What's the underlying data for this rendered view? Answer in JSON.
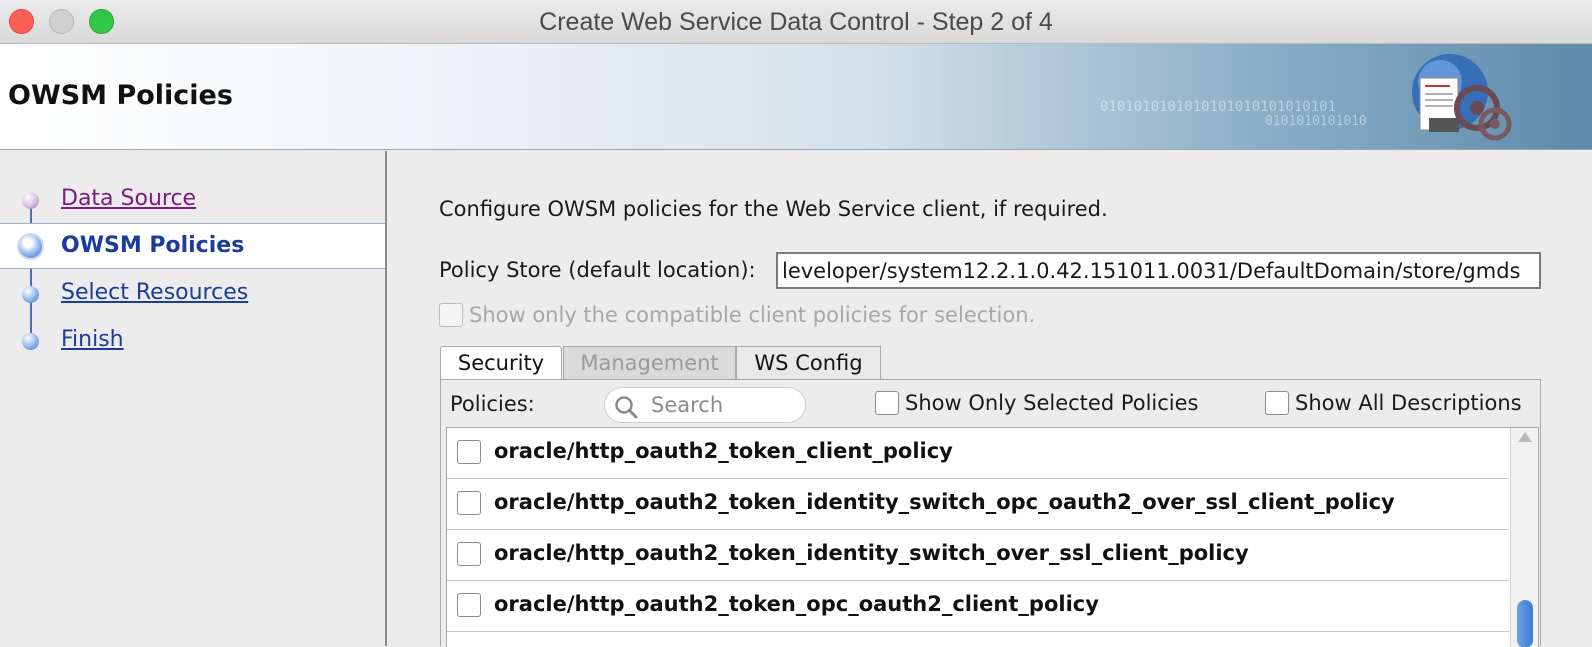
{
  "window": {
    "title": "Create Web Service Data Control - Step 2 of 4"
  },
  "banner": {
    "title": "OWSM Policies",
    "binary_line1": "0101010101010101010101010101",
    "binary_line2": "0101010101010"
  },
  "nav": {
    "items": [
      {
        "label": "Data Source",
        "state": "visited"
      },
      {
        "label": "OWSM Policies",
        "state": "active"
      },
      {
        "label": "Select Resources",
        "state": "link"
      },
      {
        "label": "Finish",
        "state": "link"
      }
    ]
  },
  "main": {
    "intro": "Configure OWSM policies for the Web Service client, if required.",
    "policy_store_label": "Policy Store (default location):",
    "policy_store_value": "leveloper/system12.2.1.0.42.151011.0031/DefaultDomain/store/gmds",
    "compatible_checkbox_label": "Show only the compatible client policies for selection."
  },
  "tabs": [
    {
      "label": "Security",
      "selected": true
    },
    {
      "label": "Management",
      "enabled": false
    },
    {
      "label": "WS Config",
      "enabled": true
    }
  ],
  "policies_panel": {
    "label": "Policies:",
    "search_placeholder": "Search",
    "show_only_selected_label": "Show Only Selected Policies",
    "show_all_descriptions_label": "Show All Descriptions",
    "rows": [
      {
        "name": "oracle/http_oauth2_token_client_policy",
        "checked": false
      },
      {
        "name": "oracle/http_oauth2_token_identity_switch_opc_oauth2_over_ssl_client_policy",
        "checked": false
      },
      {
        "name": "oracle/http_oauth2_token_identity_switch_over_ssl_client_policy",
        "checked": false
      },
      {
        "name": "oracle/http_oauth2_token_opc_oauth2_client_policy",
        "checked": false
      }
    ]
  },
  "colors": {
    "link": "#1c3c9c",
    "visited_link": "#7d1a7f",
    "close_button": "#fc5f57",
    "maximize_button": "#33c748"
  }
}
